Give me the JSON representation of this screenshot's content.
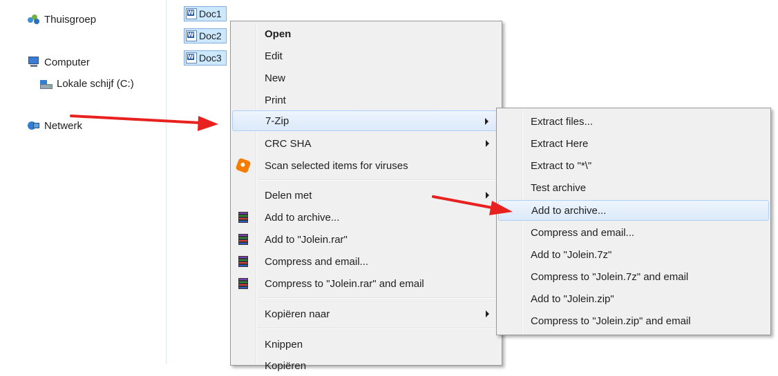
{
  "nav": {
    "items": [
      {
        "label": "Thuisgroep",
        "icon": "homegroup-icon"
      },
      {
        "label": "Computer",
        "icon": "computer-icon"
      },
      {
        "label": "Lokale schijf (C:)",
        "icon": "drive-icon"
      },
      {
        "label": "Netwerk",
        "icon": "network-icon"
      }
    ]
  },
  "files": [
    {
      "name": "Doc1"
    },
    {
      "name": "Doc2"
    },
    {
      "name": "Doc3"
    }
  ],
  "context_menu": {
    "items": [
      {
        "label": "Open"
      },
      {
        "label": "Edit"
      },
      {
        "label": "New"
      },
      {
        "label": "Print"
      },
      {
        "label": "7-Zip"
      },
      {
        "label": "CRC SHA"
      },
      {
        "label": "Scan selected items for viruses"
      },
      {
        "label": "Delen met"
      },
      {
        "label": "Add to archive..."
      },
      {
        "label": "Add to \"Jolein.rar\""
      },
      {
        "label": "Compress and email..."
      },
      {
        "label": "Compress to \"Jolein.rar\" and email"
      },
      {
        "label": "Kopiëren naar"
      },
      {
        "label": "Knippen"
      },
      {
        "label": "Kopiëren"
      }
    ]
  },
  "submenu_7zip": {
    "items": [
      {
        "label": "Extract files..."
      },
      {
        "label": "Extract Here"
      },
      {
        "label": "Extract to \"*\\\""
      },
      {
        "label": "Test archive"
      },
      {
        "label": "Add to archive..."
      },
      {
        "label": "Compress and email..."
      },
      {
        "label": "Add to \"Jolein.7z\""
      },
      {
        "label": "Compress to \"Jolein.7z\" and email"
      },
      {
        "label": "Add to \"Jolein.zip\""
      },
      {
        "label": "Compress to \"Jolein.zip\" and email"
      }
    ]
  },
  "colors": {
    "highlight_border": "#aecff7",
    "selection_fill": "#cce8ff",
    "annotation_arrow": "#e8201e"
  }
}
